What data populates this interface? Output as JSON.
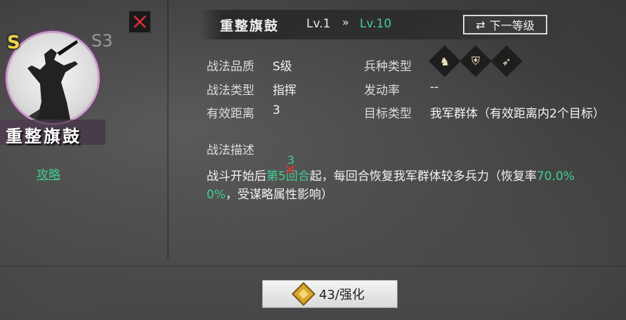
{
  "hero": {
    "rank": "S",
    "season": "S3",
    "name": "重整旗鼓",
    "guide_link": "攻略"
  },
  "header": {
    "skill_name": "重整旗鼓",
    "level_current": "Lv.1",
    "arrow": "»",
    "level_max": "Lv.10",
    "next_level_button": "下一等级",
    "next_level_icon": "swap-arrows-icon"
  },
  "attributes": {
    "quality_label": "战法品质",
    "quality_value": "S级",
    "type_label": "战法类型",
    "type_value": "指挥",
    "range_label": "有效距离",
    "range_value": "3",
    "troop_label": "兵种类型",
    "troop_icons": [
      "cavalry-icon",
      "shield-icon",
      "archer-icon"
    ],
    "trigger_label": "发动率",
    "trigger_value": "--",
    "target_label": "目标类型",
    "target_value": "我军群体（有效距离内2个目标）"
  },
  "description": {
    "title": "描述",
    "title_full": "战法描述",
    "line1_pre": "战斗开始后",
    "line1_green": "第5回合",
    "line1_post": "起，每回合恢复我军群体较多兵力（恢复率",
    "line1_rate": "70.0%",
    "line2_rate": "0%",
    "line2_post": "，受谋略属性影响）",
    "annotation_number": "3"
  },
  "footer": {
    "enhance_label": "43/强化"
  },
  "colors": {
    "accent_green": "#3fcf8f",
    "rank_gold": "#f0d24a",
    "close_red": "#e03030"
  }
}
